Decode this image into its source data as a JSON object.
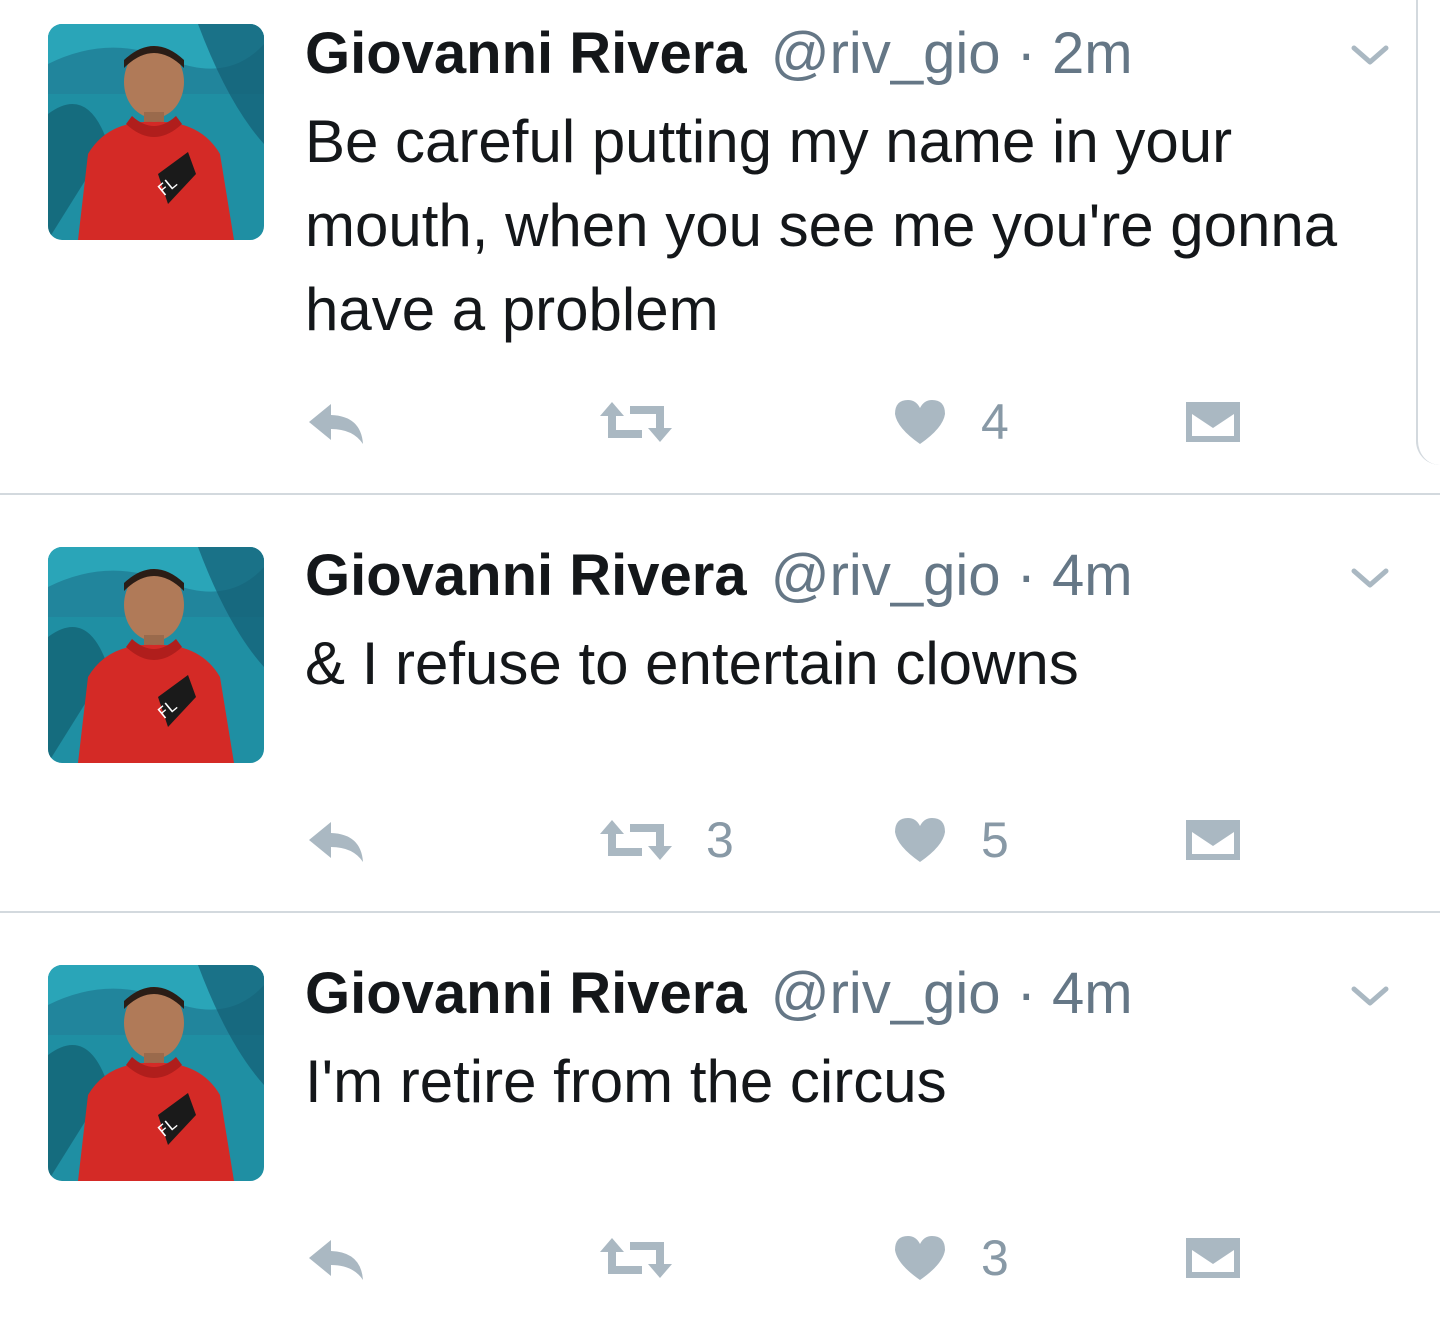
{
  "tweets": [
    {
      "name": "Giovanni Rivera",
      "handle": "@riv_gio",
      "separator": "·",
      "time": "2m",
      "text": "Be careful putting my name in your mouth, when you see me you're gonna have a problem",
      "retweets": "",
      "likes": "4"
    },
    {
      "name": "Giovanni Rivera",
      "handle": "@riv_gio",
      "separator": "·",
      "time": "4m",
      "text": "& I refuse to entertain clowns",
      "retweets": "3",
      "likes": "5"
    },
    {
      "name": "Giovanni Rivera",
      "handle": "@riv_gio",
      "separator": "·",
      "time": "4m",
      "text": "I'm retire from the circus",
      "retweets": "",
      "likes": "3"
    }
  ],
  "icons": {
    "reply": "reply-icon",
    "retweet": "retweet-icon",
    "like": "heart-icon",
    "dm": "envelope-icon",
    "menu": "chevron-down-icon"
  },
  "colors": {
    "icon_gray": "#aab8c2",
    "text_secondary": "#657786",
    "divider": "#d3d9de"
  }
}
